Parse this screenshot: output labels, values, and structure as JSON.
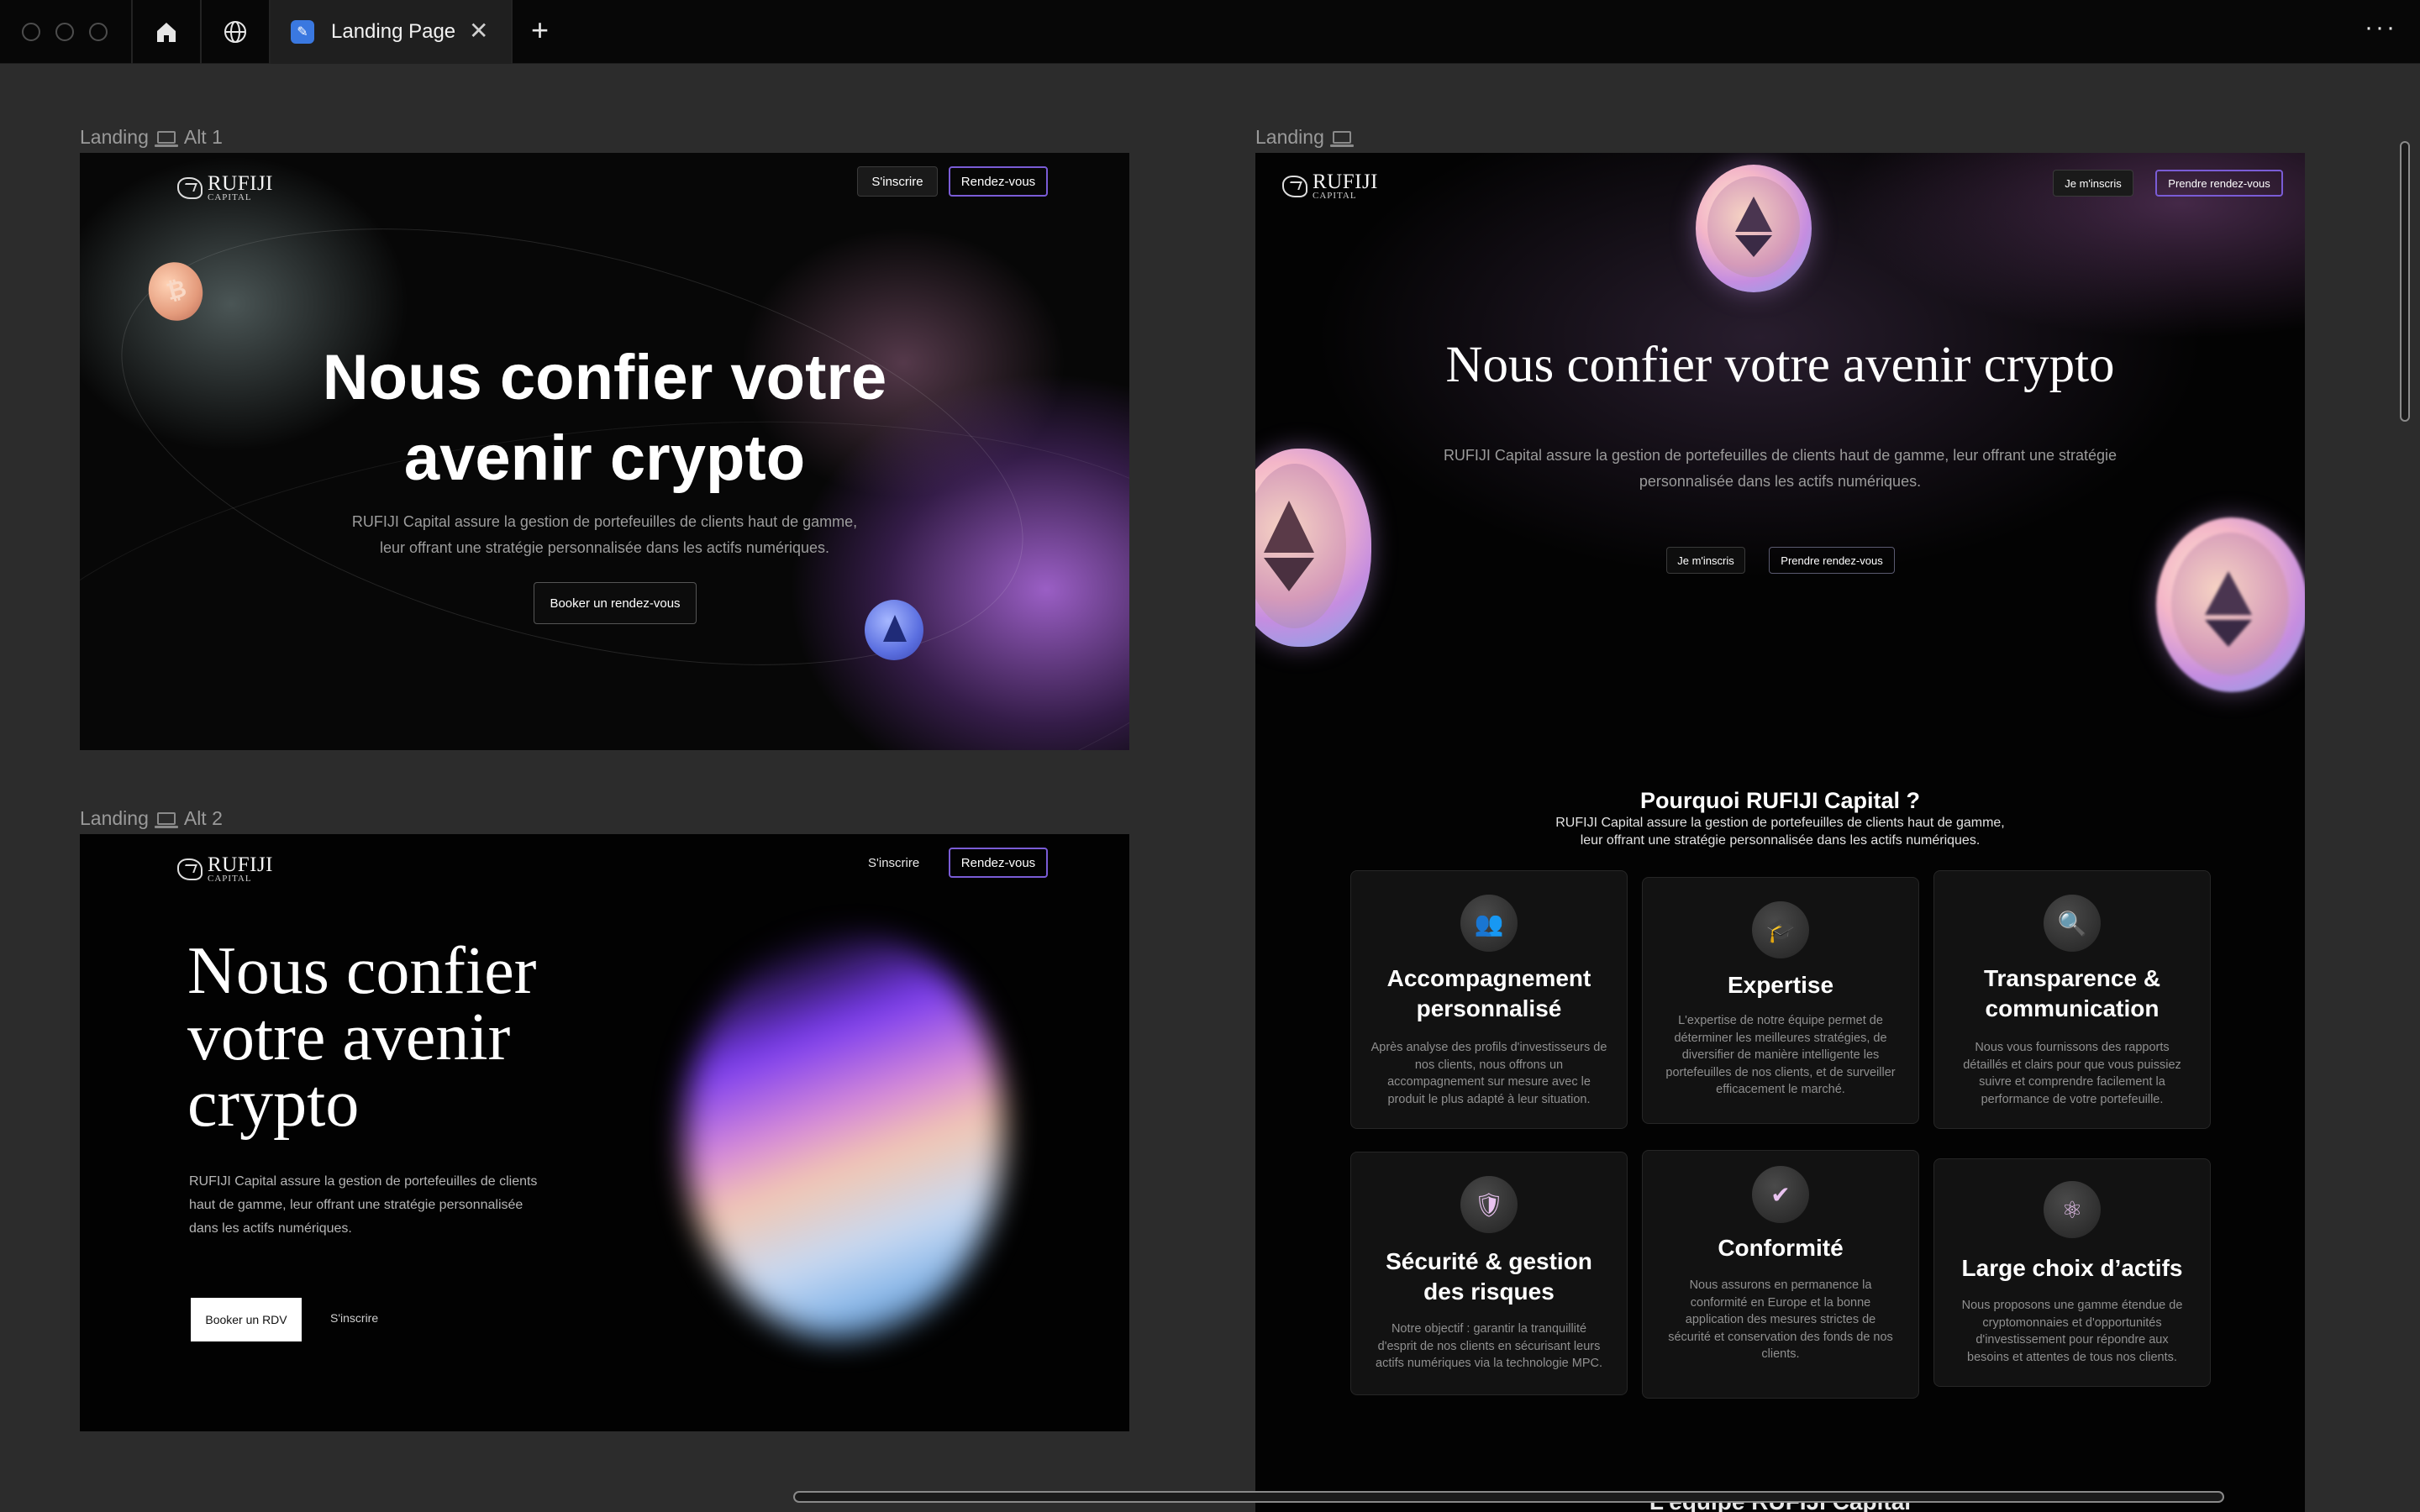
{
  "browser": {
    "tab_title": "Landing Page",
    "tab_close": "✕",
    "new_tab": "+",
    "more_menu": "···"
  },
  "frames": {
    "alt1_label": "Landing",
    "alt1_suffix": "Alt 1",
    "alt2_label": "Landing",
    "alt2_suffix": "Alt 2",
    "main_label": "Landing"
  },
  "brand": {
    "name": "RUFIJI",
    "sub": "CAPITAL"
  },
  "alt1": {
    "nav_signup": "S'inscrire",
    "nav_appointment": "Rendez-vous",
    "headline_line1": "Nous confier votre",
    "headline_line2": "avenir crypto",
    "subtext_line1": "RUFIJI Capital assure la gestion de portefeuilles de clients haut de gamme,",
    "subtext_line2": "leur offrant une stratégie personnalisée dans les actifs numériques.",
    "cta": "Booker un rendez-vous"
  },
  "alt2": {
    "nav_signup": "S'inscrire",
    "nav_appointment": "Rendez-vous",
    "headline_line1": "Nous confier",
    "headline_line2": "votre avenir",
    "headline_line3": "crypto",
    "subtext_line1": "RUFIJI Capital assure la gestion de portefeuilles de clients",
    "subtext_line2": "haut de gamme, leur offrant une stratégie personnalisée",
    "subtext_line3": "dans les actifs numériques.",
    "cta_primary": "Booker un RDV",
    "cta_secondary": "S'inscrire"
  },
  "landing": {
    "nav_signup": "Je m'inscris",
    "nav_appointment": "Prendre rendez-vous",
    "headline": "Nous confier votre avenir crypto",
    "subtext_line1": "RUFIJI Capital assure la gestion de portefeuilles de clients haut de gamme, leur offrant une stratégie",
    "subtext_line2": "personnalisée dans les actifs numériques.",
    "cta_signup": "Je m'inscris",
    "cta_appointment": "Prendre rendez-vous",
    "why_title": "Pourquoi RUFIJI Capital ?",
    "why_sub_line1": "RUFIJI Capital assure la gestion de portefeuilles de clients haut de gamme,",
    "why_sub_line2": "leur offrant une stratégie personnalisée dans les actifs numériques.",
    "team_title": "L’équipe RUFIJI Capital",
    "cards": [
      {
        "icon": "people-icon",
        "title_line1": "Accompagnement",
        "title_line2": "personnalisé",
        "body": [
          "Après analyse des profils d'investisseurs de",
          "nos clients, nous offrons un",
          "accompagnement sur mesure avec le",
          "produit le plus adapté à leur situation."
        ]
      },
      {
        "icon": "graduation-cap-icon",
        "title_line1": "Expertise",
        "title_line2": "",
        "body": [
          "L'expertise de notre équipe permet de",
          "déterminer les meilleures stratégies, de",
          "diversifier de manière intelligente les",
          "portefeuilles de nos clients, et de surveiller",
          "efficacement le marché."
        ]
      },
      {
        "icon": "magnifier-icon",
        "title_line1": "Transparence &",
        "title_line2": "communication",
        "body": [
          "Nous vous fournissons des rapports",
          "détaillés et clairs pour que vous puissiez",
          "suivre et comprendre facilement la",
          "performance de votre portefeuille."
        ]
      },
      {
        "icon": "shield-icon",
        "title_line1": "Sécurité & gestion",
        "title_line2": "des risques",
        "body": [
          "Notre objectif : garantir la tranquillité",
          "d'esprit de nos clients en sécurisant leurs",
          "actifs numériques via la technologie MPC."
        ]
      },
      {
        "icon": "badge-check-icon",
        "title_line1": "Conformité",
        "title_line2": "",
        "body": [
          "Nous assurons en permanence la",
          "conformité en Europe et la bonne",
          "application des mesures strictes de",
          "sécurité et conservation des fonds de nos",
          "clients."
        ]
      },
      {
        "icon": "network-icon",
        "title_line1": "Large choix d’actifs",
        "title_line2": "",
        "body": [
          "Nous proposons une gamme étendue de",
          "cryptomonnaies et d'opportunités",
          "d'investissement pour répondre aux",
          "besoins et attentes de tous nos clients."
        ]
      }
    ]
  },
  "colors": {
    "accent_purple": "#7a5cd6",
    "background": "#2c2c2c",
    "topbar": "#070707"
  }
}
